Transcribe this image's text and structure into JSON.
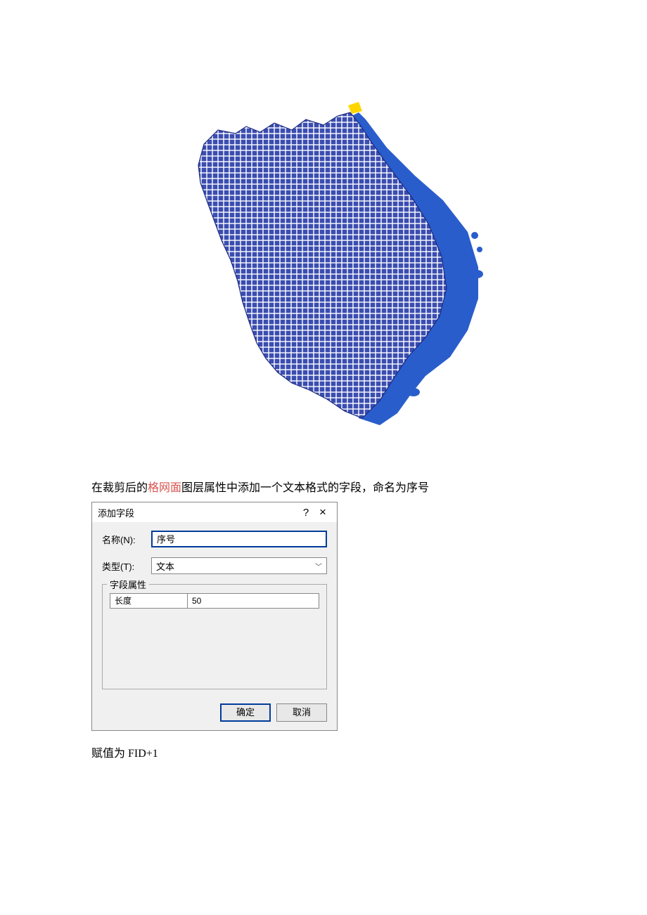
{
  "caption": {
    "prefix": "在裁剪后的",
    "highlight": "格网面",
    "suffix": "图层属性中添加一个文本格式的字段，命名为序号"
  },
  "dialog": {
    "title": "添加字段",
    "help_symbol": "?",
    "close_symbol": "×",
    "name_label": "名称(N):",
    "name_value": "序号",
    "type_label": "类型(T):",
    "type_value": "文本",
    "fieldset_legend": "字段属性",
    "length_label": "长度",
    "length_value": "50",
    "ok": "确定",
    "cancel": "取消"
  },
  "footnote": "赋值为 FID+1"
}
